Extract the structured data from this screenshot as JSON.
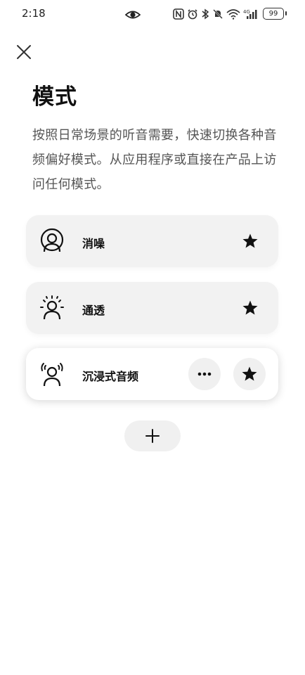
{
  "status_bar": {
    "time": "2:18",
    "battery": "99",
    "icons": [
      "eye-icon",
      "nfc-icon",
      "alarm-icon",
      "bluetooth-icon",
      "silent-icon",
      "wifi-icon",
      "signal-icon",
      "battery-icon"
    ]
  },
  "header": {
    "title": "模式",
    "description": "按照日常场景的听音需要，快速切换各种音频偏好模式。从应用程序或直接在产品上访问任何模式。"
  },
  "modes": [
    {
      "label": "消噪",
      "icon": "noise-cancelling-icon",
      "active": false
    },
    {
      "label": "通透",
      "icon": "transparency-icon",
      "active": false
    },
    {
      "label": "沉浸式音频",
      "icon": "immersive-audio-icon",
      "active": true
    }
  ],
  "icons": {
    "close": "close-icon",
    "star": "star-icon",
    "more": "more-icon",
    "add": "plus-icon"
  }
}
